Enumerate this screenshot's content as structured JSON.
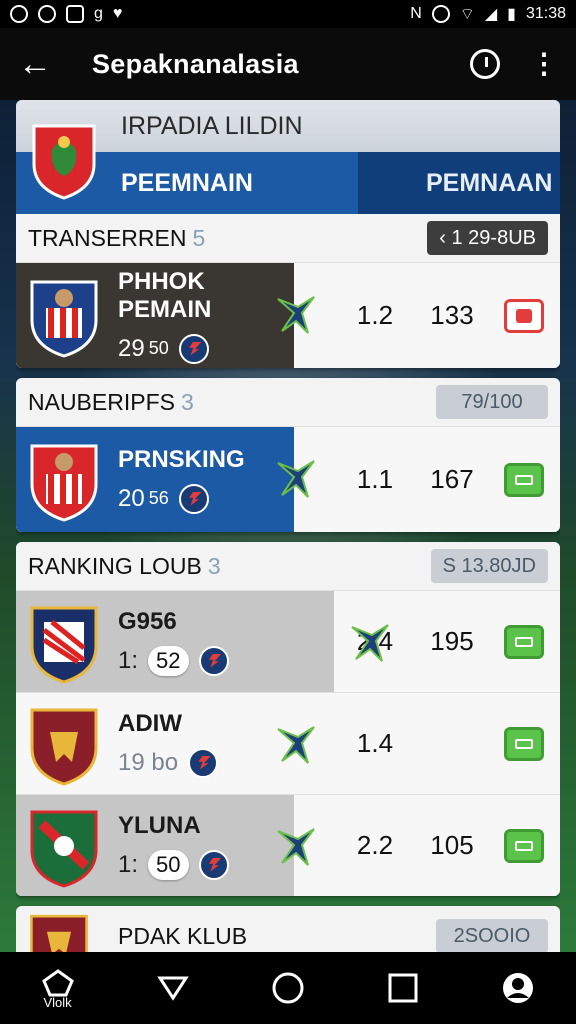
{
  "status_bar": {
    "time": "31:38"
  },
  "app_bar": {
    "title": "Sepaknanalasia",
    "back_icon": "arrow-left-icon",
    "history_icon": "clock-icon",
    "menu_icon": "more-vert-icon"
  },
  "league": {
    "title": "IRPADIA LILDIN",
    "tabs": [
      "PEEMNAIN",
      "PEMNAAN"
    ]
  },
  "sections": [
    {
      "title": "TRANSERREN",
      "count": "5",
      "pill": "1 29-8UB",
      "pill_style": "dark",
      "rows": [
        {
          "name": "PHHOK PEMAIN",
          "sub": "29",
          "sub_small": "50",
          "stat1": "1.2",
          "stat2": "133",
          "action": "red"
        }
      ]
    },
    {
      "title": "NAUBERIPFS",
      "count": "3",
      "pill": "79/100",
      "pill_style": "light",
      "rows": [
        {
          "name": "PRNSKING",
          "sub": "20",
          "sub_small": "56",
          "stat1": "1.1",
          "stat2": "167",
          "action": "green"
        }
      ]
    },
    {
      "title": "RANKING LOUB",
      "count": "3",
      "pill": "S 13.80JD",
      "pill_style": "light",
      "rows": [
        {
          "name": "G956",
          "sub": "1:",
          "bubble": "52",
          "stat1": "2.4",
          "stat2": "195",
          "action": "green"
        },
        {
          "name": "ADIW",
          "sub": "19 bo",
          "stat1": "1.4",
          "stat2": "",
          "action": "green"
        },
        {
          "name": "YLUNA",
          "sub": "1:",
          "bubble": "50",
          "stat1": "2.2",
          "stat2": "105",
          "action": "green"
        }
      ]
    },
    {
      "title": "PDAK KLUB",
      "pill": "2SOOIO",
      "pill_style": "light",
      "rows": []
    }
  ],
  "nav": {
    "items": [
      {
        "label": "Vlolk",
        "icon": "home-icon"
      },
      {
        "label": "",
        "icon": "back-triangle-icon"
      },
      {
        "label": "",
        "icon": "home-circle-icon"
      },
      {
        "label": "",
        "icon": "recents-square-icon"
      },
      {
        "label": "",
        "icon": "profile-icon"
      }
    ]
  },
  "colors": {
    "primary": "#1d5aa6",
    "dark_tab": "#0f3e7a",
    "accent_red": "#e23c3c",
    "accent_green": "#5bc24a"
  }
}
